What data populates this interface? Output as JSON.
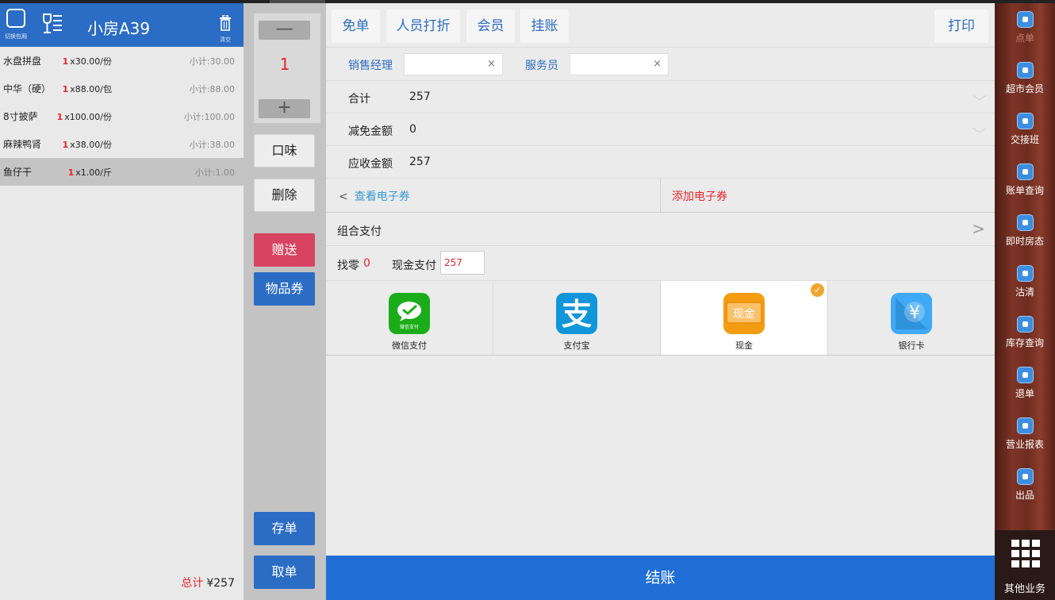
{
  "order": {
    "switch_room_label": "切换包厢",
    "room_name": "小房A39",
    "clear_label": "清空",
    "items": [
      {
        "name": "水盘拼盘",
        "qty": "1",
        "unit_price": "x30.00/份",
        "subtotal": "小计:30.00"
      },
      {
        "name": "中华（硬）",
        "qty": "1",
        "unit_price": "x88.00/包",
        "subtotal": "小计:88.00"
      },
      {
        "name": "8寸披萨",
        "qty": "1",
        "unit_price": "x100.00/份",
        "subtotal": "小计:100.00"
      },
      {
        "name": "麻辣鸭肾",
        "qty": "1",
        "unit_price": "x38.00/份",
        "subtotal": "小计:38.00"
      },
      {
        "name": "鱼仔干",
        "qty": "1",
        "unit_price": "x1.00/斤",
        "subtotal": "小计:1.00"
      }
    ],
    "total_label": "总计",
    "total_value": "¥257"
  },
  "controls": {
    "minus": "—",
    "quantity": "1",
    "plus": "+",
    "taste": "口味",
    "delete": "删除",
    "gift": "赠送",
    "voucher": "物品券",
    "save_order": "存单",
    "take_order": "取单"
  },
  "toolbar": {
    "free": "免单",
    "staff_discount": "人员打折",
    "member": "会员",
    "on_account": "挂账",
    "print": "打印"
  },
  "staff": {
    "sales_manager_label": "销售经理",
    "sales_manager_value": "",
    "waiter_label": "服务员",
    "waiter_value": "",
    "clear_symbol": "×"
  },
  "amounts": {
    "total_label": "合计",
    "total_value": "257",
    "discount_label": "减免金额",
    "discount_value": "0",
    "receivable_label": "应收金额",
    "receivable_value": "257"
  },
  "coupon": {
    "view_label": "查看电子券",
    "add_label": "添加电子券"
  },
  "combined_payment_label": "组合支付",
  "change": {
    "change_label": "找零",
    "change_value": "0",
    "cash_label": "现金支付",
    "cash_value": "257"
  },
  "payment_methods": [
    {
      "name": "微信支付",
      "icon": "wechat-pay-icon",
      "badge": "微信支付",
      "color": "#1aad19",
      "selected": false
    },
    {
      "name": "支付宝",
      "icon": "alipay-icon",
      "badge": "支",
      "color": "#1296db",
      "selected": false
    },
    {
      "name": "现金",
      "icon": "cash-icon",
      "badge": "现金",
      "color": "#f39c12",
      "selected": true
    },
    {
      "name": "银行卡",
      "icon": "bank-card-icon",
      "badge": "¥",
      "color": "#3fa9f5",
      "selected": false
    }
  ],
  "checkout_label": "结账",
  "sidebar": {
    "items": [
      {
        "label": "点单",
        "icon": "order-icon",
        "dim": true
      },
      {
        "label": "超市会员",
        "icon": "member-icon",
        "dim": false
      },
      {
        "label": "交接班",
        "icon": "shift-icon",
        "dim": false
      },
      {
        "label": "账单查询",
        "icon": "bill-query-icon",
        "dim": false
      },
      {
        "label": "即时房态",
        "icon": "room-status-icon",
        "dim": false
      },
      {
        "label": "沽清",
        "icon": "sold-out-icon",
        "dim": false
      },
      {
        "label": "库存查询",
        "icon": "stock-query-icon",
        "dim": false
      },
      {
        "label": "退单",
        "icon": "refund-icon",
        "dim": false
      },
      {
        "label": "营业报表",
        "icon": "report-icon",
        "dim": false
      },
      {
        "label": "出品",
        "icon": "dispatch-icon",
        "dim": false
      }
    ],
    "more_label": "其他业务"
  },
  "colors": {
    "primary_blue": "#2b6cc4",
    "checkout_blue": "#1f6fd6",
    "accent_red": "#e5262c",
    "gift_red": "#d74360",
    "selected_check": "#f3a42d"
  }
}
